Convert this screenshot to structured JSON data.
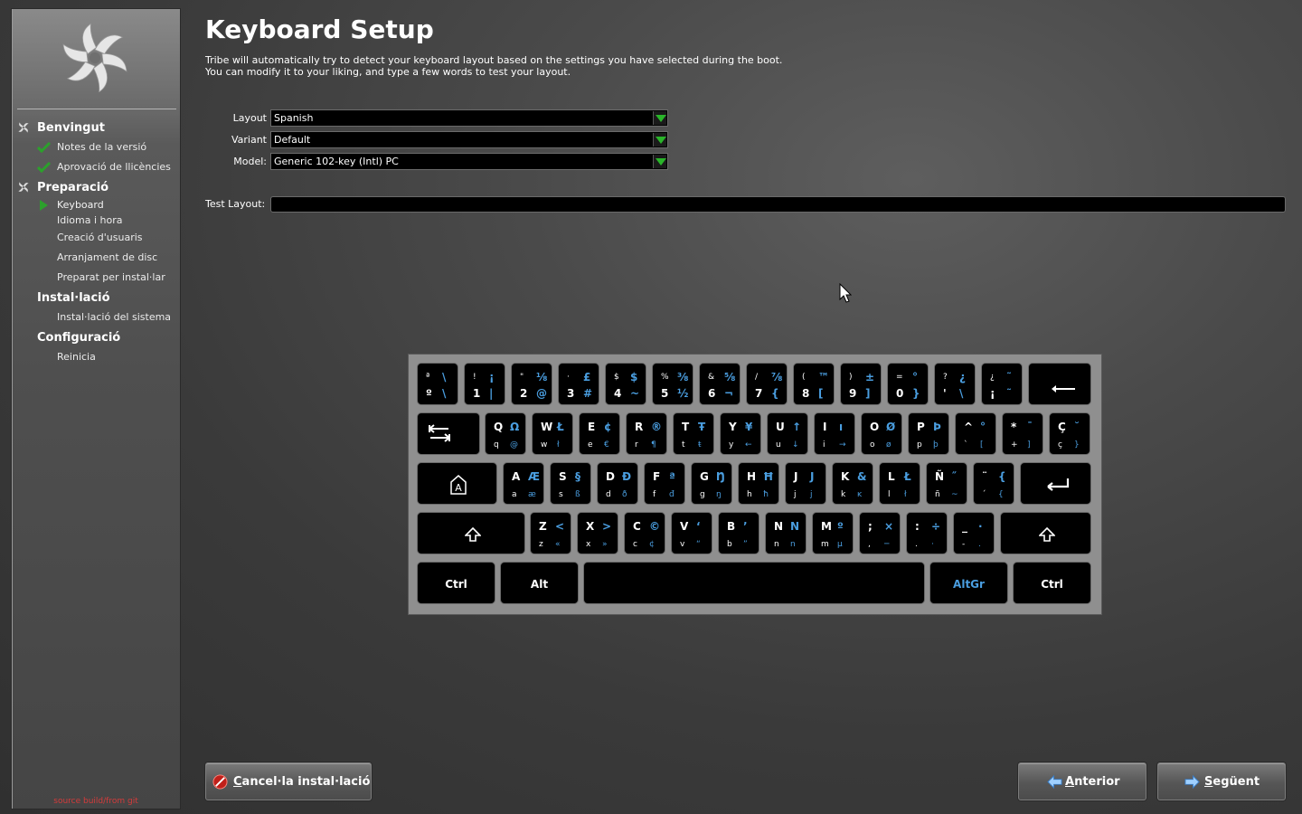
{
  "sidebar": {
    "sections": [
      {
        "label": "Benvingut",
        "items": [
          "Notes de la versió",
          "Aprovació de llicències"
        ]
      },
      {
        "label": "Preparació",
        "items": [
          "Keyboard",
          "Idioma i hora",
          "Creació d'usuaris",
          "Arranjament de disc",
          "Preparat per instal·lar"
        ]
      },
      {
        "label": "Instal·lació",
        "items": [
          "Instal·lació del sistema"
        ]
      },
      {
        "label": "Configuració",
        "items": [
          "Reinicia"
        ]
      }
    ],
    "footer": "source build/from git"
  },
  "page": {
    "title": "Keyboard Setup",
    "desc1": "Tribe will automatically try to detect your keyboard layout based on the settings you have selected during the boot.",
    "desc2": "You can modify it to your liking, and type a few words to test your layout."
  },
  "form": {
    "layout_label": "Layout",
    "layout_value": "Spanish",
    "variant_label": "Variant",
    "variant_value": "Default",
    "model_label": "Model:",
    "model_value": "Generic 102-key (Intl) PC",
    "test_label": "Test Layout:",
    "test_value": ""
  },
  "keyboard": {
    "rows": [
      [
        [
          "ª",
          "\\",
          "º",
          "\\"
        ],
        [
          "!",
          "¡",
          "1",
          "|"
        ],
        [
          "\"",
          "⅛",
          "2",
          "@"
        ],
        [
          "·",
          "£",
          "3",
          "#"
        ],
        [
          "$",
          "$",
          "4",
          "~"
        ],
        [
          "%",
          "⅜",
          "5",
          "½"
        ],
        [
          "&",
          "⅝",
          "6",
          "¬"
        ],
        [
          "/",
          "⅞",
          "7",
          "{"
        ],
        [
          "(",
          "™",
          "8",
          "["
        ],
        [
          ")",
          "±",
          "9",
          "]"
        ],
        [
          "=",
          "°",
          "0",
          "}"
        ],
        [
          "?",
          "¿",
          "'",
          "\\"
        ],
        [
          "¿",
          "˜",
          "¡",
          "˜"
        ]
      ],
      [
        [
          "Q",
          "Ω",
          "q",
          "@"
        ],
        [
          "W",
          "Ł",
          "w",
          "ł"
        ],
        [
          "E",
          "¢",
          "e",
          "€"
        ],
        [
          "R",
          "®",
          "r",
          "¶"
        ],
        [
          "T",
          "Ŧ",
          "t",
          "ŧ"
        ],
        [
          "Y",
          "¥",
          "y",
          "←"
        ],
        [
          "U",
          "↑",
          "u",
          "↓"
        ],
        [
          "I",
          "ı",
          "i",
          "→"
        ],
        [
          "O",
          "Ø",
          "o",
          "ø"
        ],
        [
          "P",
          "Þ",
          "p",
          "þ"
        ],
        [
          "^",
          "°",
          "`",
          "["
        ],
        [
          "*",
          "¯",
          "+",
          "]"
        ],
        [
          "Ç",
          "˘",
          "ç",
          "}"
        ]
      ],
      [
        [
          "A",
          "Æ",
          "a",
          "æ"
        ],
        [
          "S",
          "§",
          "s",
          "ß"
        ],
        [
          "D",
          "Ð",
          "d",
          "ð"
        ],
        [
          "F",
          "ª",
          "f",
          "đ"
        ],
        [
          "G",
          "Ŋ",
          "g",
          "ŋ"
        ],
        [
          "H",
          "Ħ",
          "h",
          "ħ"
        ],
        [
          "J",
          "J",
          "j",
          "j"
        ],
        [
          "K",
          "&",
          "k",
          "ĸ"
        ],
        [
          "L",
          "Ł",
          "l",
          "ł"
        ],
        [
          "Ñ",
          "˝",
          "ñ",
          "~"
        ],
        [
          "¨",
          "{",
          "´",
          "{"
        ]
      ],
      [
        [
          "Z",
          "<",
          "z",
          "«"
        ],
        [
          "X",
          ">",
          "x",
          "»"
        ],
        [
          "C",
          "©",
          "c",
          "¢"
        ],
        [
          "V",
          "‘",
          "v",
          "“"
        ],
        [
          "B",
          "’",
          "b",
          "”"
        ],
        [
          "N",
          "N",
          "n",
          "n"
        ],
        [
          "M",
          "º",
          "m",
          "µ"
        ],
        [
          ";",
          "×",
          ",",
          "─"
        ],
        [
          ":",
          "÷",
          ".",
          "·"
        ],
        [
          "_",
          "·",
          "-",
          "."
        ]
      ]
    ],
    "ctrl_left": "Ctrl",
    "alt": "Alt",
    "altgr": "AltGr",
    "ctrl_right": "Ctrl",
    "backspace_icon": "backspace-arrow-icon",
    "tab_icon": "tab-arrows-icon",
    "caps_icon": "caps-lock-icon",
    "enter_icon": "enter-icon",
    "shift_icon": "shift-icon"
  },
  "buttons": {
    "cancel_prefix": "C",
    "cancel_rest": "ancel·la instal·lació",
    "prev_prefix": "A",
    "prev_rest": "nterior",
    "next_prefix": "S",
    "next_rest": "egüent"
  },
  "colors": {
    "accent_blue": "#4a9ee0",
    "check_green": "#2ca02c",
    "footer_red": "#d43b3b",
    "cancel_red": "#c0201a"
  }
}
